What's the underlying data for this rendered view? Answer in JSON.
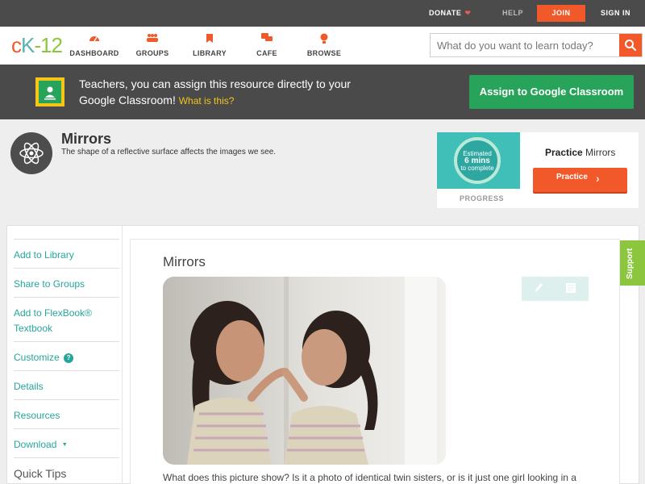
{
  "topbar": {
    "donate": "DONATE",
    "help": "HELP",
    "join": "JOIN",
    "signin": "SIGN IN"
  },
  "logo": {
    "part1": "c",
    "part2": "K",
    "part3": "-12"
  },
  "nav": {
    "items": [
      {
        "label": "DASHBOARD",
        "icon": "dashboard-icon"
      },
      {
        "label": "GROUPS",
        "icon": "groups-icon"
      },
      {
        "label": "LIBRARY",
        "icon": "library-icon"
      },
      {
        "label": "CAFE",
        "icon": "cafe-icon"
      },
      {
        "label": "BROWSE",
        "icon": "browse-icon"
      }
    ],
    "search_placeholder": "What do you want to learn today?"
  },
  "banner": {
    "message": "Teachers, you can assign this resource directly to your Google Classroom!",
    "what_link": "What is this?",
    "assign_button": "Assign to Google Classroom"
  },
  "concept": {
    "title": "Mirrors",
    "description": "The shape of a reflective surface affects the images we see."
  },
  "practice": {
    "estimated_line1": "Estimated",
    "estimated_line2": "6 mins",
    "estimated_line3": "to complete",
    "progress_label": "PROGRESS",
    "title_bold": "Practice",
    "title_rest": "Mirrors",
    "button": "Practice"
  },
  "sidebar": {
    "items": [
      {
        "label": "Add to Library"
      },
      {
        "label": "Share to Groups"
      },
      {
        "label": "Add to FlexBook® Textbook"
      },
      {
        "label": "Customize"
      },
      {
        "label": "Details"
      },
      {
        "label": "Resources"
      },
      {
        "label": "Download"
      },
      {
        "label": "Quick Tips"
      }
    ],
    "customize_help": "?",
    "download_caret": "▼"
  },
  "content": {
    "title": "Mirrors",
    "text": "What does this picture show? Is it a photo of identical twin sisters, or is it just one girl looking in a"
  },
  "support": {
    "label": "Support"
  },
  "colors": {
    "accent": "#f1592a",
    "teal": "#26a69a",
    "green": "#27a35a",
    "dark": "#4b4b4b"
  }
}
